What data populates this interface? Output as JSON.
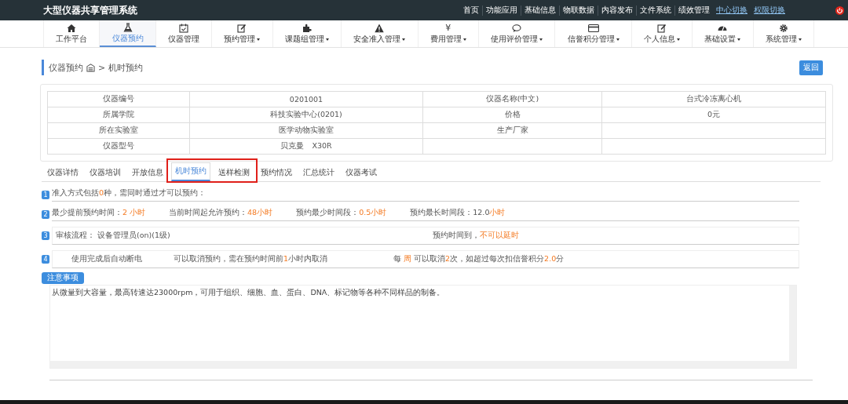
{
  "app_title": "大型仪器共享管理系统",
  "top_links": [
    {
      "label": "首页",
      "underlined": false
    },
    {
      "label": "功能应用",
      "underlined": false
    },
    {
      "label": "基础信息",
      "underlined": false
    },
    {
      "label": "物联数据",
      "underlined": false
    },
    {
      "label": "内容发布",
      "underlined": false
    },
    {
      "label": "文件系统",
      "underlined": false
    },
    {
      "label": "绩效管理",
      "underlined": false
    },
    {
      "label": "中心切换",
      "underlined": true
    },
    {
      "label": "权限切换",
      "underlined": true
    }
  ],
  "nav": [
    {
      "label": "工作平台",
      "dropdown": false,
      "selected": false
    },
    {
      "label": "仪器预约",
      "dropdown": false,
      "selected": true
    },
    {
      "label": "仪器管理",
      "dropdown": false,
      "selected": false
    },
    {
      "label": "预约管理",
      "dropdown": true,
      "selected": false
    },
    {
      "label": "课题组管理",
      "dropdown": true,
      "selected": false
    },
    {
      "label": "安全准入管理",
      "dropdown": true,
      "selected": false
    },
    {
      "label": "费用管理",
      "icon_text": "¥",
      "dropdown": true,
      "selected": false
    },
    {
      "label": "使用评价管理",
      "dropdown": true,
      "selected": false
    },
    {
      "label": "信誉积分管理",
      "dropdown": true,
      "selected": false
    },
    {
      "label": "个人信息",
      "dropdown": true,
      "selected": false
    },
    {
      "label": "基础设置",
      "dropdown": true,
      "selected": false
    },
    {
      "label": "系统管理",
      "dropdown": true,
      "selected": false
    }
  ],
  "breadcrumb": {
    "parent": "仪器预约",
    "separator": ">",
    "current": "机时预约"
  },
  "back_button": "返回",
  "info_table": [
    {
      "label_1": "仪器编号",
      "value_1": "0201001",
      "label_2": "仪器名称(中文)",
      "value_2": "台式冷冻离心机"
    },
    {
      "label_1": "所属学院",
      "value_1": "科技实验中心(0201)",
      "label_2": "价格",
      "value_2": "0元"
    },
    {
      "label_1": "所在实验室",
      "value_1": "医学动物实验室",
      "label_2": "生产厂家"
    },
    {
      "label_1": "仪器型号",
      "value_1": "贝克曼　X30R"
    }
  ],
  "tabs": [
    {
      "label": "仪器详情",
      "selected": false,
      "highlighted": false
    },
    {
      "label": "仪器培训",
      "selected": false,
      "highlighted": false
    },
    {
      "label": "开放信息",
      "selected": false,
      "highlighted": false
    },
    {
      "label": "机时预约",
      "selected": true,
      "highlighted": true
    },
    {
      "label": "送样检测",
      "selected": false,
      "highlighted": true
    },
    {
      "label": "预约情况",
      "selected": false,
      "highlighted": false
    },
    {
      "label": "汇总统计",
      "selected": false,
      "highlighted": false
    },
    {
      "label": "仪器考试",
      "selected": false,
      "highlighted": false
    }
  ],
  "rules": [
    {
      "number": "1",
      "boxed": false,
      "groups": [
        [
          {
            "text": "准入方式包括",
            "highlight": false
          },
          {
            "text": "0",
            "highlight": true
          },
          {
            "text": "种，需同时通过才可以预约：",
            "highlight": false
          }
        ]
      ]
    },
    {
      "number": "2",
      "boxed": false,
      "groups": [
        [
          {
            "text": "最少提前预约时间：",
            "highlight": false
          },
          {
            "text": "2 小时",
            "highlight": true
          }
        ],
        [
          {
            "text": "当前时间起允许预约：",
            "highlight": false
          },
          {
            "text": "48小时",
            "highlight": true
          }
        ],
        [
          {
            "text": "预约最少时间段：",
            "highlight": false
          },
          {
            "text": "0.5小时",
            "highlight": true
          }
        ],
        [
          {
            "text": "预约最长时间段：12.0",
            "highlight": false
          },
          {
            "text": "小时",
            "highlight": true
          }
        ]
      ]
    },
    {
      "number": "3",
      "boxed": true,
      "groups": [
        [
          {
            "text": "审核流程：  设备管理员(on)(1级)",
            "highlight": false
          }
        ],
        [
          {
            "text": "预约时间到，",
            "highlight": false
          },
          {
            "text": "不可以延时",
            "highlight": true
          }
        ]
      ]
    },
    {
      "number": "4",
      "boxed": true,
      "groups": [
        [
          {
            "text": "使用完成后自动断电",
            "highlight": false
          }
        ],
        [
          {
            "text": "可以取消预约，需在预约时间前",
            "highlight": false
          },
          {
            "text": "1",
            "highlight": true
          },
          {
            "text": "小时内取消",
            "highlight": false
          }
        ],
        [
          {
            "text": "每 ",
            "highlight": false
          },
          {
            "text": "周",
            "highlight": true
          },
          {
            "text": " 可以取消",
            "highlight": false
          },
          {
            "text": "2",
            "highlight": true
          },
          {
            "text": "次，如超过每次扣信誉积分",
            "highlight": false
          },
          {
            "text": "2.0",
            "highlight": true
          },
          {
            "text": "分",
            "highlight": false
          }
        ]
      ]
    }
  ],
  "notes": {
    "label": "注意事项",
    "text": "从微量到大容量，最高转速达23000rpm，可用于组织、细胞、血、蛋白、DNA、标记物等各种不同样品的制备。"
  }
}
